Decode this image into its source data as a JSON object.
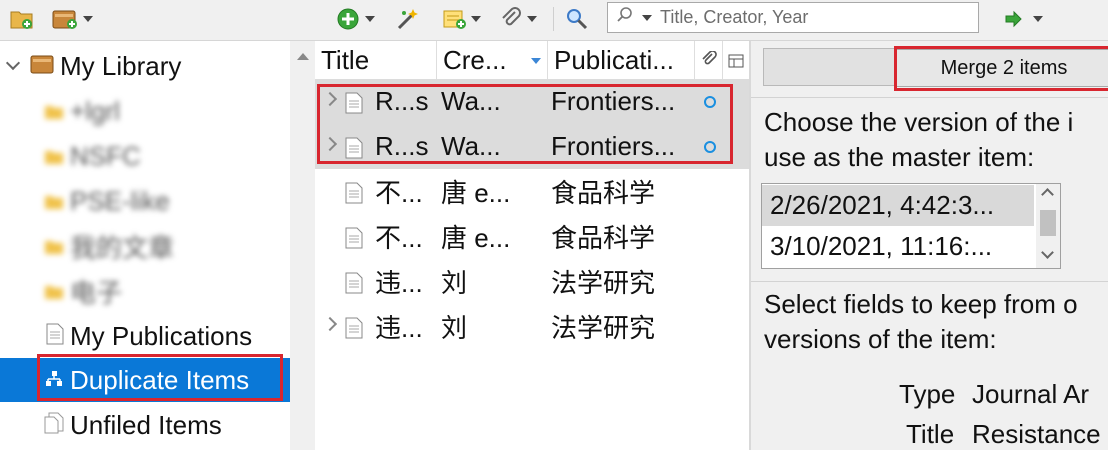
{
  "toolbar": {
    "new_collection_icon": "folder-add-icon",
    "new_library_icon": "library-add-icon",
    "new_item_icon": "green-plus-icon",
    "add_by_identifier_icon": "magic-wand-icon",
    "new_note_icon": "note-icon",
    "attach_icon": "paperclip-icon",
    "advanced_search_icon": "magnifier-icon",
    "search_placeholder": "Title, Creator, Year",
    "sync_icon": "green-arrow-icon",
    "accent_green": "#3aa53a"
  },
  "sidebar": {
    "library_label": "My Library",
    "collections": [
      "+lgrl",
      "NSFC",
      "PSE-like",
      "我的文章",
      "电子"
    ],
    "publications_label": "My Publications",
    "duplicates_label": "Duplicate Items",
    "unfiled_label": "Unfiled Items",
    "selected_color": "#0a78d7"
  },
  "items": {
    "columns": {
      "title": "Title",
      "creator": "Cre...",
      "publication": "Publicati..."
    },
    "rows": [
      {
        "title": "R...s",
        "creator": "Wa...",
        "publication": "Frontiers...",
        "expandable": true,
        "selected": true,
        "has_attachment": true
      },
      {
        "title": "R...s",
        "creator": "Wa...",
        "publication": "Frontiers...",
        "expandable": true,
        "selected": true,
        "has_attachment": true
      },
      {
        "title": "不...",
        "creator": "唐 e...",
        "publication": "食品科学",
        "expandable": false,
        "selected": false,
        "has_attachment": false
      },
      {
        "title": "不...",
        "creator": "唐 e...",
        "publication": "食品科学",
        "expandable": false,
        "selected": false,
        "has_attachment": false
      },
      {
        "title": "违...",
        "creator": "刘",
        "publication": "法学研究",
        "expandable": false,
        "selected": false,
        "has_attachment": false
      },
      {
        "title": "违...",
        "creator": "刘",
        "publication": "法学研究",
        "expandable": true,
        "selected": false,
        "has_attachment": false
      }
    ]
  },
  "merge": {
    "button_label": "Merge 2 items",
    "choose_line1": "Choose the version of the i",
    "choose_line2": "use as the master item:",
    "versions": [
      "2/26/2021, 4:42:3...",
      "3/10/2021, 11:16:..."
    ],
    "select_line1": "Select fields to keep from o",
    "select_line2": "versions of the item:",
    "fields": [
      {
        "name": "Type",
        "value": "Journal Ar"
      },
      {
        "name": "Title",
        "value": "Resistance"
      }
    ]
  },
  "highlight_color": "#d8262f"
}
